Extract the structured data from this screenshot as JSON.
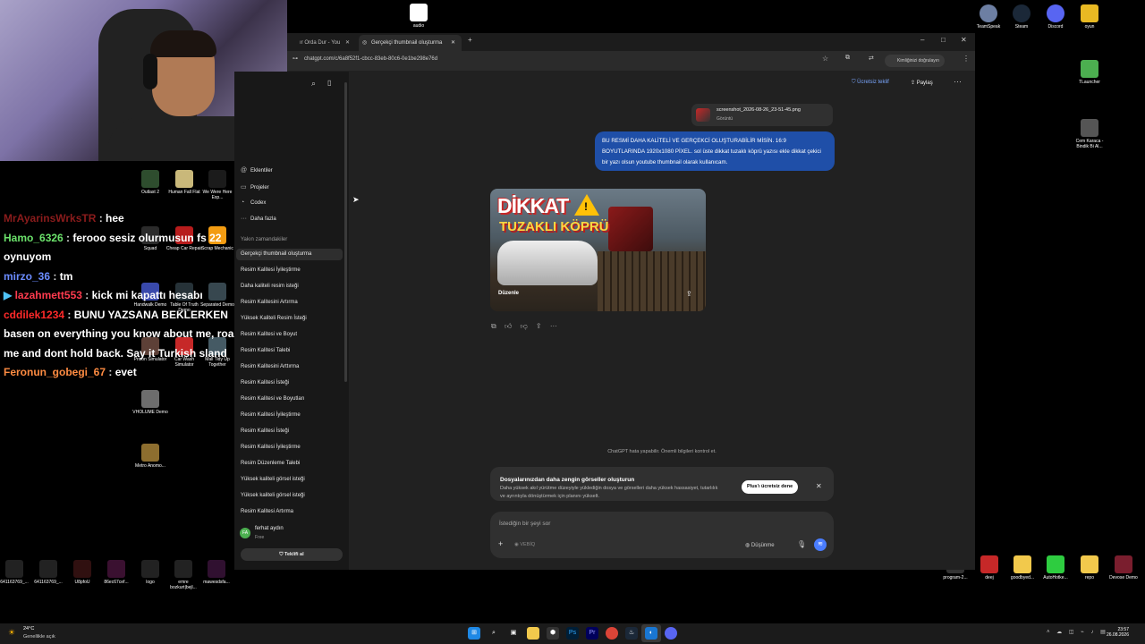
{
  "desktop_icons_right": [
    {
      "label": "TeamSpeak",
      "color": "#6d7fa3"
    },
    {
      "label": "Steam",
      "color": "#1b2838"
    },
    {
      "label": "Discord",
      "color": "#5865f2"
    },
    {
      "label": "oyun",
      "color": "#c8102e"
    }
  ],
  "desktop_icon_audio": "audio",
  "desktop_icons_right2": [
    {
      "label": "TLauncher"
    },
    {
      "label": "Cem Karaca - Bindik Bi Al..."
    }
  ],
  "desktop_icons_bottom_right": [
    {
      "label": "program-2..."
    },
    {
      "label": "deej"
    },
    {
      "label": "goodbyed..."
    },
    {
      "label": "AutoHotke..."
    },
    {
      "label": "repo"
    },
    {
      "label": "Devose Demo"
    }
  ],
  "desktop_icons_bottom_left": [
    {
      "label": "641163769_..."
    },
    {
      "label": "641163769_..."
    },
    {
      "label": "U8pfoU"
    },
    {
      "label": "86ec67cef..."
    },
    {
      "label": "logo"
    },
    {
      "label": "emre bozkurt|bejl..."
    },
    {
      "label": "mawesdsfa..."
    }
  ],
  "desktop_icons_mid": [
    {
      "label": "Outlast 2"
    },
    {
      "label": "Human Fall Flat"
    },
    {
      "label": "We Were Here Exp..."
    },
    {
      "label": "Squad"
    },
    {
      "label": "Cheap Car Repair"
    },
    {
      "label": "Scrap Mechanic"
    },
    {
      "label": "Handwalk Demo"
    },
    {
      "label": "Table Of Truth Demo"
    },
    {
      "label": "Separated Demo"
    },
    {
      "label": "Prison Simulator"
    },
    {
      "label": "Car Wash Simulator"
    },
    {
      "label": "Mall Tidy Up Together"
    },
    {
      "label": "VHOLUME Demo"
    },
    {
      "label": "Metro Anomo..."
    }
  ],
  "chat": [
    {
      "user": "MrAyarinsWrksTR",
      "message": "hee",
      "color": "#8b1c1c"
    },
    {
      "user": "Hamo_6326",
      "message": "ferooo sesiz olurmusun fs 22 oynuyom",
      "color": "#6be26b"
    },
    {
      "user": "mirzo_36",
      "message": "tm",
      "color": "#6b8cff"
    },
    {
      "user": "lazahmett553",
      "message": "kick mi kapattı hesabı",
      "color": "#ff3b4e"
    },
    {
      "user": "cddilek1234",
      "message": "BUNU YAZSANA BEKLERKEN basen on everything you know about me, roast me and dont hold back. Say it Turkish sland",
      "color": "#ff2a2a"
    },
    {
      "user": "Feronun_gobegi_67",
      "message": "evet",
      "color": "#ff8c42"
    }
  ],
  "browser": {
    "tab1": "ır Orda Dur - You",
    "tab2": "Gerçekçi thumbnail oluşturma",
    "url": "chatgpt.com/c/6a8f52f1-cbcc-83eb-80c6-0e1be298e76d",
    "verify_label": "Kimliğinizi doğrulayın"
  },
  "sidebar": {
    "nav": [
      {
        "icon": "@",
        "label": "Eklentiler"
      },
      {
        "icon": "▭",
        "label": "Projeler"
      },
      {
        "icon": "◔",
        "label": "Codex"
      },
      {
        "icon": "···",
        "label": "Daha fazla"
      }
    ],
    "section_title": "Yakın zamandakiler",
    "chats": [
      "Gerçekçi thumbnail oluşturma",
      "Resim Kalitesi İyileştirme",
      "Daha kaliteli resim isteği",
      "Resim Kalitesini Artırma",
      "Yüksek Kaliteli Resim İsteği",
      "Resim Kalitesi ve Boyut",
      "Resim Kalitesi Talebi",
      "Resim Kalitesini Arttırma",
      "Resim Kalitesi İsteği",
      "Resim Kalitesi ve Boyutları",
      "Resim Kalitesi İyileştirme",
      "Resim Kalitesi İsteği",
      "Resim Kalitesi İyileştirme",
      "Resim Düzenleme Talebi",
      "Yüksek kaliteli görsel isteği",
      "Yüksek kaliteli görsel isteği",
      "Resim Kalitesi Artırma"
    ],
    "user_initials": "FA",
    "user_name": "ferhat aydın",
    "user_plan": "Free",
    "offer_button": "Teklifi al"
  },
  "main": {
    "header_offer": "Ücretsiz teklif",
    "header_share": "Paylaş",
    "file_name": "screenshot_2026-08-26_23-51-45.png",
    "file_type": "Görüntü",
    "user_message": "BU RESMİ DAHA KALİTELİ VE GERÇEKCİ OLUŞTURABİLİR MİSİN. 16:9 BOYUTLARINDA 1920x1080 PİXEL. sol üste dikkat tuzaklı köprü yazısı ekle dikkat çekici bir yazı olsun youtube thumbnail olarak kullanıcam.",
    "image_title_1": "DİKKAT",
    "image_title_2": "TUZAKLI KÖPRÜ",
    "image_edit": "Düzenle",
    "disclaimer": "ChatGPT hata yapabilir. Önemli bilgileri kontrol et.",
    "promo_title": "Dosyalarınızdan daha zengin görseller oluşturun",
    "promo_body": "Daha yüksek akıl yürütme düzeyiyle yüklediğin dosya ve görselleri daha yüksek hassasiyet, tutarlılık ve ayrıntıyla dönüştürmek için planını yükselt.",
    "promo_button": "Plus'ı ücretsiz dene",
    "composer_placeholder": "İstediğin bir şeyi sor",
    "composer_mode": "VEBİQ",
    "composer_think": "Düşünme"
  },
  "taskbar": {
    "temp": "24°C",
    "weather": "Genellikle açık",
    "time": "23:57",
    "date": "26.08.2026"
  }
}
